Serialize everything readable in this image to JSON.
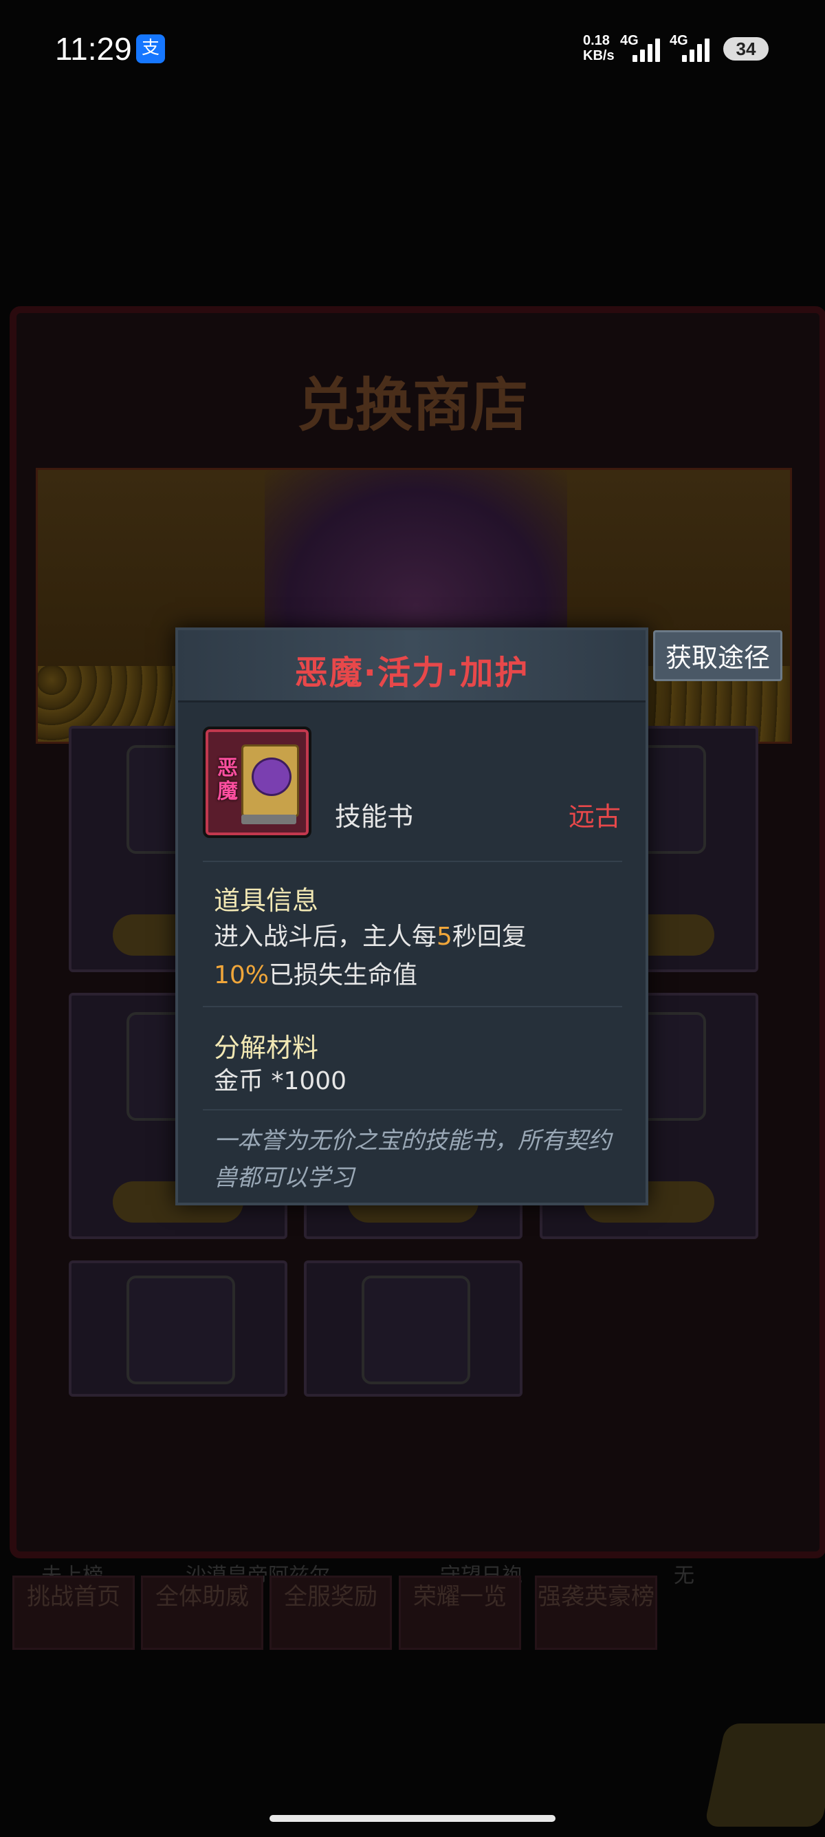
{
  "status_bar": {
    "time": "11:29",
    "alipay_icon": "支",
    "net_speed_value": "0.18",
    "net_speed_unit": "KB/s",
    "signal1_label": "4G",
    "signal2_label": "4G",
    "battery": "34"
  },
  "background": {
    "shop_title": "兑换商店",
    "footer_labels": [
      "未上榜",
      "沙漠皇帝阿兹尔",
      "守望日袍",
      "无"
    ],
    "bottom_buttons": [
      "挑战首页",
      "全体助威",
      "全服奖励",
      "荣耀一览",
      "强袭英豪榜"
    ]
  },
  "popup": {
    "title": "恶魔·活力·加护",
    "get_button": "获取途径",
    "item_badge": "恶魔",
    "item_type": "技能书",
    "item_rarity": "远古",
    "info_title": "道具信息",
    "info_line1_a": "进入战斗后，主人每",
    "info_line1_num": "5",
    "info_line1_b": "秒回复",
    "info_line2_num": "10%",
    "info_line2_b": "已损失生命值",
    "decompose_title": "分解材料",
    "decompose_value": "金币 *1000",
    "flavor_text": "一本誉为无价之宝的技能书，所有契约兽都可以学习"
  },
  "colors": {
    "title_red": "#e8484a",
    "highlight_orange": "#f0a63a",
    "section_cream": "#f2e8b4",
    "flavor_grey": "#9aa8b6"
  }
}
